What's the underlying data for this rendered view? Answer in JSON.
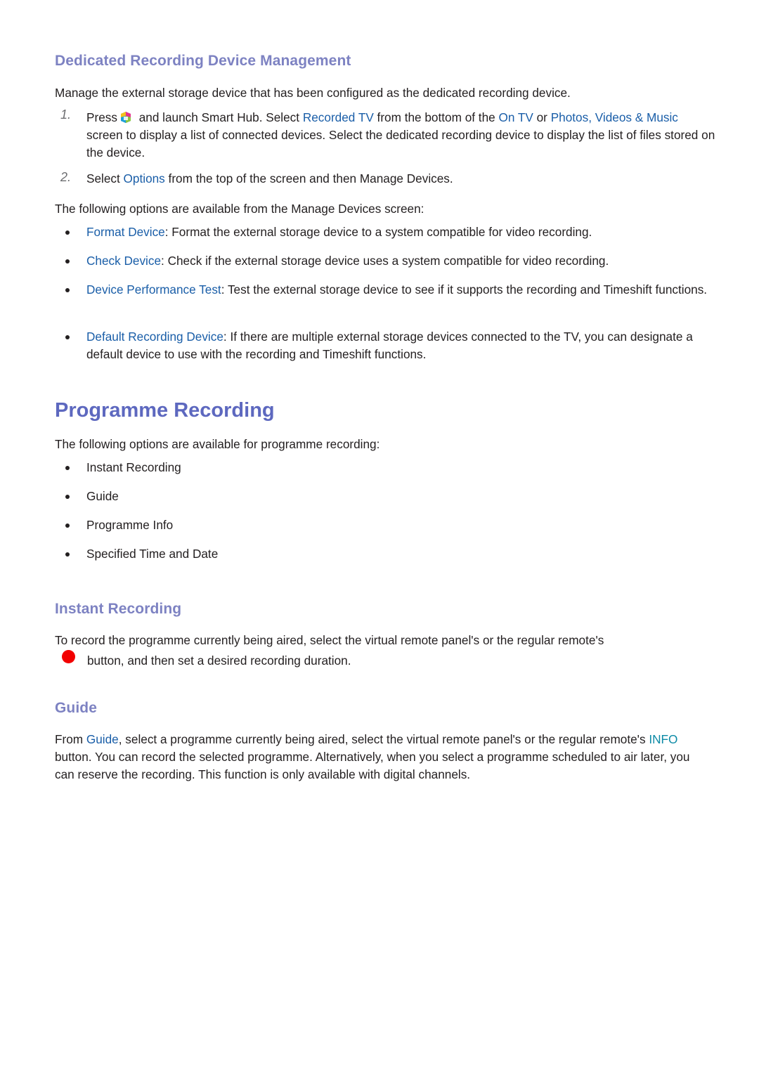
{
  "section1": {
    "heading": "Dedicated Recording Device Management",
    "intro": "Manage the external storage device that has been configured as the dedicated recording device.",
    "steps": [
      {
        "number": "1.",
        "parts": {
          "a": "Press",
          "icon": "smart-hub-icon",
          "b": " and launch Smart Hub. Select ",
          "link1": "Recorded TV",
          "c": " from the bottom of the ",
          "link2": "On TV",
          "d": " or ",
          "link3": "Photos,",
          "link3b": "Videos & Music",
          "e": " screen to display a list of connected devices. Select the dedicated recording device to display the list of files stored on the device."
        }
      },
      {
        "number": "2.",
        "parts": {
          "a": "Select ",
          "link1": "Options",
          "b": " from the top of the screen and then Manage Devices."
        }
      }
    ],
    "options_intro": "The following options are available from the Manage Devices screen:",
    "options": [
      {
        "term": "Format Device",
        "desc": ": Format the external storage device to a system compatible for video recording."
      },
      {
        "term": "Check Device",
        "desc": ": Check if the external storage device uses a system compatible for video recording."
      },
      {
        "term": "Device Performance Test",
        "desc": ": Test the external storage device to see if it supports the recording and Timeshift functions."
      },
      {
        "term": "Default Recording Device",
        "desc": ": If there are multiple external storage devices connected to the TV, you can designate a default device to use with the recording and Timeshift functions."
      }
    ]
  },
  "section2": {
    "heading": "Programme Recording",
    "intro": "The following options are available for programme recording:",
    "items": [
      "Instant Recording",
      "Guide",
      "Programme Info",
      "Specified Time and Date"
    ]
  },
  "instant_recording": {
    "heading": "Instant Recording",
    "line1": "To record the programme currently being aired, select the virtual remote panel's or the regular remote's",
    "icon": "record-button-icon",
    "line2": "button, and then set a desired recording duration."
  },
  "guide": {
    "heading": "Guide",
    "a": "From ",
    "link1": "Guide",
    "b": ", select a programme currently being aired, select the virtual remote panel's or the regular remote's ",
    "link2": "INFO",
    "c": " button. You can record the selected programme. Alternatively, when you select a programme scheduled to air later, you can reserve the recording. This function is only available with digital channels."
  },
  "colors": {
    "heading": "#7d82c2",
    "title": "#5d68bf",
    "link": "#1a5ea8",
    "info_link": "#0c8aa6",
    "record": "#f20000"
  }
}
